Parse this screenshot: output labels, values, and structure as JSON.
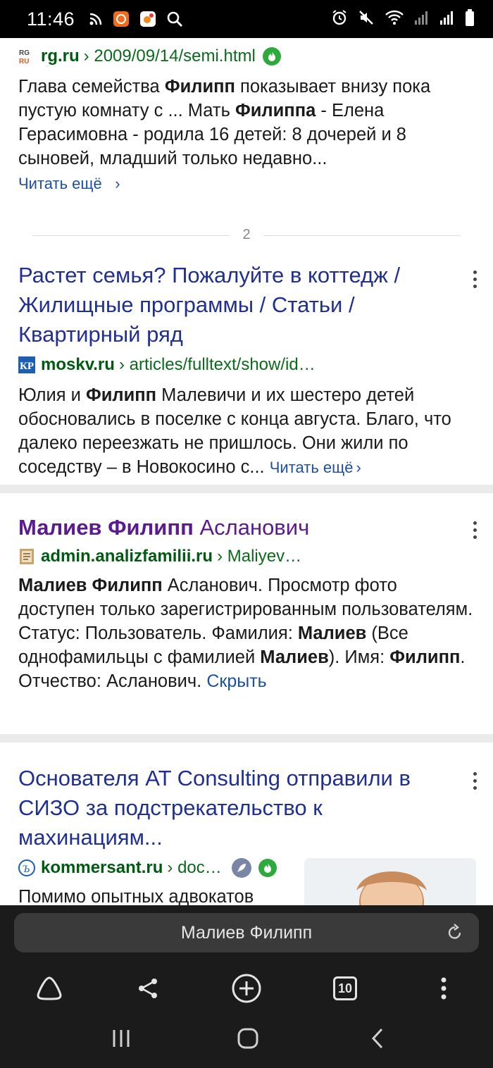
{
  "status_bar": {
    "time": "11:46",
    "icons_left": [
      "rss-icon",
      "ok-app-icon",
      "odnoklassniki-app-icon",
      "search-icon"
    ],
    "icons_right": [
      "alarm-icon",
      "mute-icon",
      "wifi-icon",
      "signal-icon",
      "signal-icon-2",
      "battery-icon"
    ]
  },
  "results": [
    {
      "domain": "rg.ru",
      "path": "2009/09/14/semi.html",
      "favicon": "rg-favicon",
      "snippet_parts": [
        {
          "t": "Глава семейства ",
          "b": false
        },
        {
          "t": "Филипп",
          "b": true
        },
        {
          "t": " показывает внизу пока пустую комнату с ... Мать ",
          "b": false
        },
        {
          "t": "Филиппа",
          "b": true
        },
        {
          "t": " - Елена Герасимовна - родила 16 детей: 8 дочерей и 8 сыновей, младший только недавно...",
          "b": false
        }
      ],
      "read_more": "Читать ещё",
      "read_more_arrow": "›"
    },
    {
      "title": "Растет семья? Пожалуйте в коттедж / Жилищные программы / Статьи / Квартирный ряд",
      "domain": "moskv.ru",
      "path": "articles/fulltext/show/id…",
      "favicon": "kp-favicon",
      "snippet_parts": [
        {
          "t": "Юлия и ",
          "b": false
        },
        {
          "t": "Филипп",
          "b": true
        },
        {
          "t": " Малевичи и их шестеро детей обосновались в поселке с конца августа. Благо, что далеко переезжать не пришлось. Они жили по соседству – в Новокосино с... ",
          "b": false
        }
      ],
      "read_more": "Читать ещё",
      "read_more_arrow": "›"
    },
    {
      "title_bold": "Малиев Филипп",
      "title_rest": " Асланович",
      "domain": "admin.analizfamilii.ru",
      "path": "Maliyev…",
      "favicon": "document-favicon",
      "snippet_parts": [
        {
          "t": "Малиев Филипп",
          "b": true
        },
        {
          "t": " Асланович. Просмотр фото доступен только зарегистрированным пользователям. Статус: Пользователь. Фамилия: ",
          "b": false
        },
        {
          "t": "Малиев",
          "b": true
        },
        {
          "t": " (Все однофамильцы с фамилией ",
          "b": false
        },
        {
          "t": "Малиев",
          "b": true
        },
        {
          "t": "). Имя: ",
          "b": false
        },
        {
          "t": "Филипп",
          "b": true
        },
        {
          "t": ". Отчество: Асланович. ",
          "b": false
        }
      ],
      "hide": "Скрыть"
    },
    {
      "title": "Основателя AT Consulting отправили в СИЗО за подстрекательство к махинациям...",
      "domain": "kommersant.ru",
      "path": "doc…",
      "favicon": "kommersant-favicon",
      "snippet": "Помимо опытных адвокатов"
    }
  ],
  "page_separator": "2",
  "omnibox": {
    "query": "Малиев Филипп"
  },
  "toolbar": {
    "tabs_count": "10"
  },
  "colors": {
    "title_link": "#1f2f94",
    "title_visited": "#5b1a8f",
    "url_green": "#005b12",
    "read_more": "#1d4fa5"
  }
}
